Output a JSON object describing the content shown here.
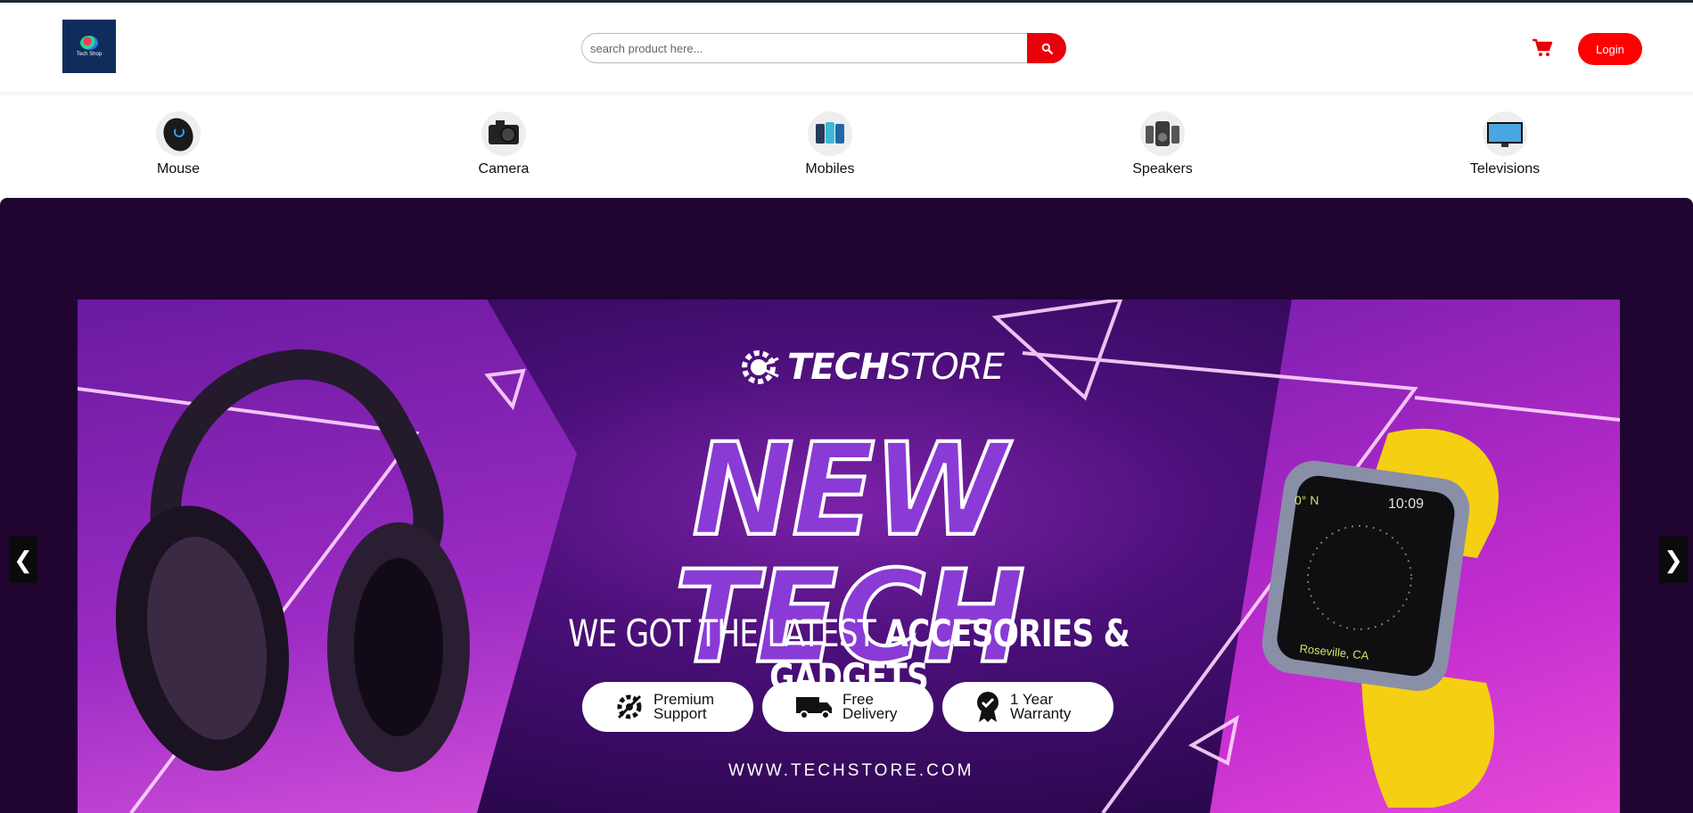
{
  "header": {
    "logo_text": "Tech Shop",
    "search_placeholder": "search product here...",
    "search_icon": "search-icon",
    "cart_icon": "cart-icon",
    "login_label": "Login",
    "accent_color": "#ff0000"
  },
  "categories": [
    {
      "label": "Mouse",
      "icon": "mouse-icon"
    },
    {
      "label": "Camera",
      "icon": "camera-icon"
    },
    {
      "label": "Mobiles",
      "icon": "mobile-icon"
    },
    {
      "label": "Speakers",
      "icon": "speaker-icon"
    },
    {
      "label": "Televisions",
      "icon": "television-icon"
    }
  ],
  "carousel": {
    "prev_label": "❮",
    "next_label": "❯",
    "slide": {
      "brand_bold": "TECH",
      "brand_light": "STORE",
      "headline": "NEW TECH",
      "tagline_light": "WE GOT THE LATEST ",
      "tagline_bold": "ACCESORIES & GADGETS",
      "badges": [
        {
          "line1": "Premium",
          "line2": "Support",
          "icon": "support-gear-icon"
        },
        {
          "line1": "Free",
          "line2": "Delivery",
          "icon": "delivery-truck-icon"
        },
        {
          "line1": "1 Year",
          "line2": "Warranty",
          "icon": "warranty-badge-icon"
        }
      ],
      "url": "WWW.TECHSTORE.COM",
      "watch_location": "Roseville, CA",
      "watch_time": "10:09",
      "watch_heading": "0° N"
    }
  }
}
